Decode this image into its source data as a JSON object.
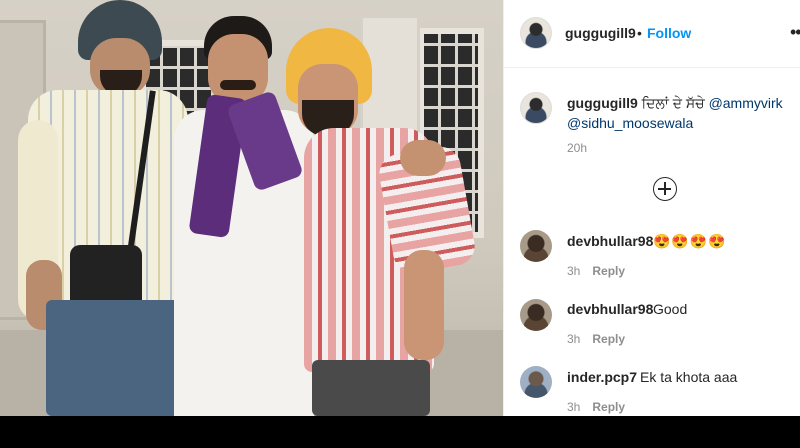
{
  "post": {
    "owner": {
      "username": "guggugill9",
      "follow_label": "Follow",
      "separator": "•"
    },
    "caption": {
      "username": "guggugill9",
      "text": "ਦਿਲਾਂ ਦੇ ਸੱਚੇ",
      "mention_1": "@ammyvirk",
      "mention_2": "@sidhu_moosewala",
      "time": "20h"
    },
    "more_icon": "more-horizontal-icon",
    "load_more_icon": "plus-circle-icon"
  },
  "comments": [
    {
      "username": "devbhullar98",
      "text": "😍😍😍😍",
      "time": "3h",
      "reply_label": "Reply"
    },
    {
      "username": "devbhullar98",
      "text": "Good",
      "time": "3h",
      "reply_label": "Reply"
    },
    {
      "username": "inder.pcp7",
      "text": "Ek ta khota aaa",
      "time": "3h",
      "reply_label": "Reply"
    }
  ],
  "colors": {
    "link": "#0095f6",
    "mention": "#00376b",
    "muted": "#8e8e8e",
    "text": "#262626"
  }
}
